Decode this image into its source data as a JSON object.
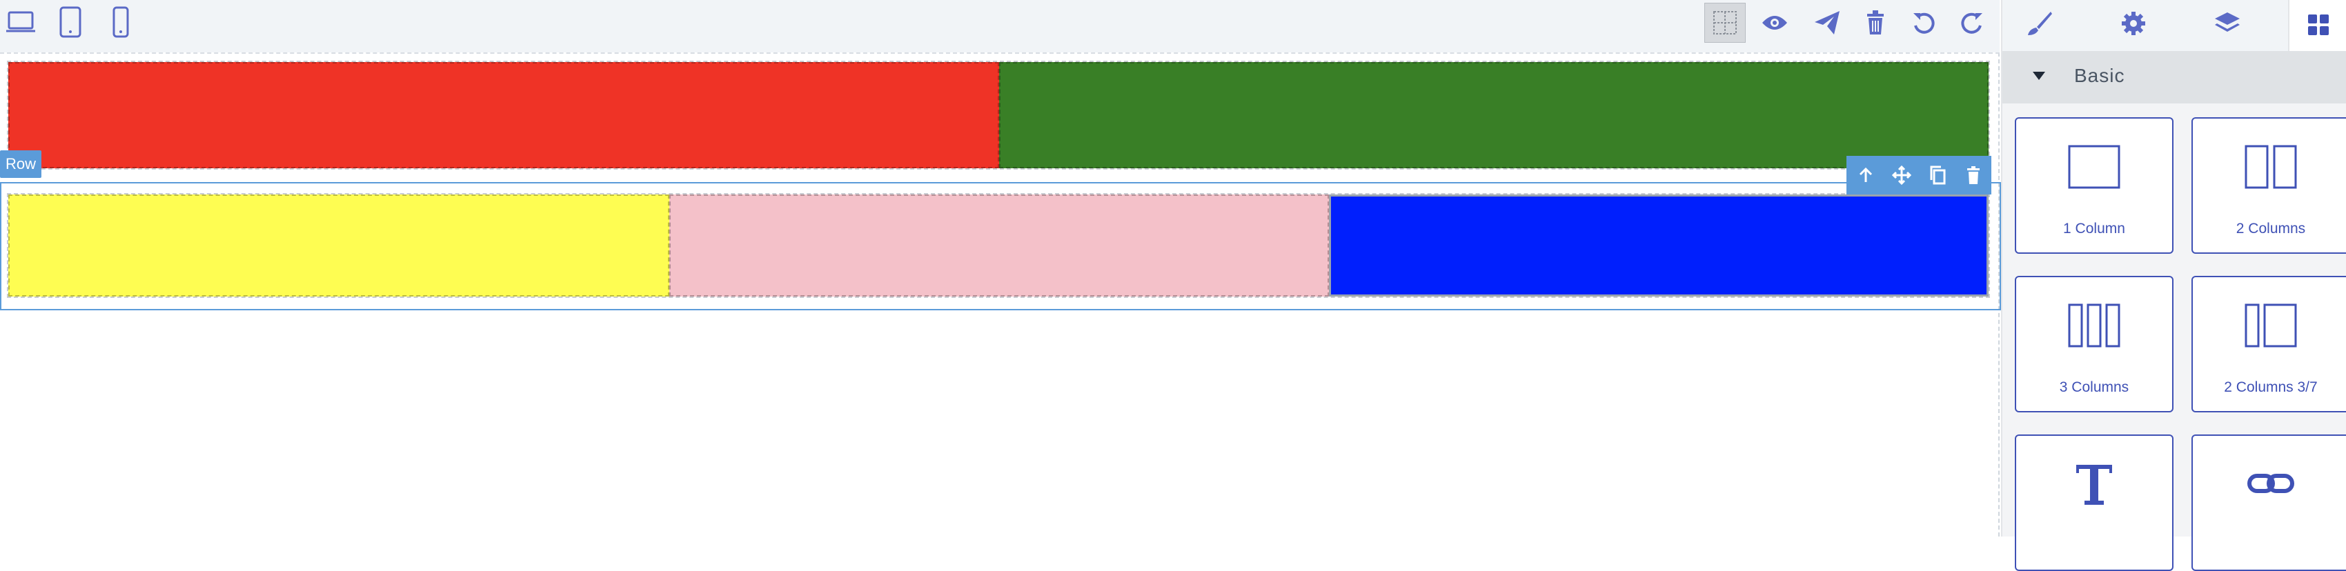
{
  "devices": [
    {
      "name": "desktop-icon"
    },
    {
      "name": "tablet-icon"
    },
    {
      "name": "mobile-icon"
    }
  ],
  "toolbar": {
    "icons": [
      "grid-icon",
      "eye-icon",
      "send-icon",
      "trash-icon",
      "undo-icon",
      "redo-icon"
    ]
  },
  "panel_tabs": [
    "brush-icon",
    "gear-icon",
    "layers-icon",
    "blocks-icon"
  ],
  "canvas": {
    "row_badge": "Row",
    "row_1": [
      {
        "color": "#ef3326"
      },
      {
        "color": "#397f26"
      }
    ],
    "row_2": [
      {
        "color": "#fefd52"
      },
      {
        "color": "#f4c1c9"
      },
      {
        "color": "#001ffd"
      }
    ],
    "row_toolbar_icons": [
      "arrow-up-icon",
      "move-icon",
      "copy-icon",
      "delete-icon"
    ]
  },
  "blocks": {
    "category": "Basic",
    "items": [
      {
        "label": "1 Column",
        "icon": "one-column-icon"
      },
      {
        "label": "2 Columns",
        "icon": "two-columns-icon"
      },
      {
        "label": "3 Columns",
        "icon": "three-columns-icon"
      },
      {
        "label": "2 Columns 3/7",
        "icon": "two-columns-37-icon"
      },
      {
        "label": "",
        "icon": "text-icon"
      },
      {
        "label": "",
        "icon": "link-icon"
      }
    ]
  },
  "colors": {
    "accent": "#5b9bd9",
    "block_blue": "#3f51b5",
    "toolbar_icon": "#5b6ac6"
  }
}
